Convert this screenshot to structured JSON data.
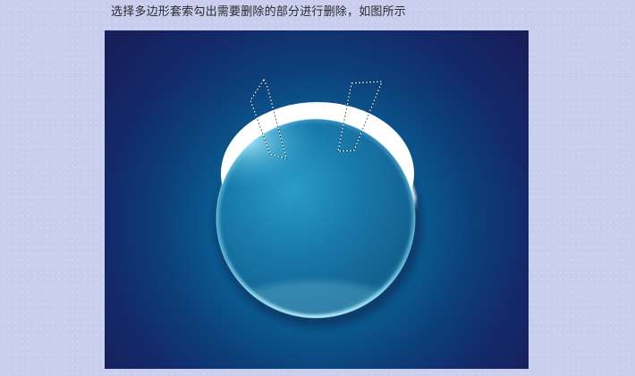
{
  "caption": "选择多边形套索勾出需要删除的部分进行删除，如图所示",
  "canvas": {
    "background_inner": "#0e6fa0",
    "background_outer": "#171f5a",
    "orb_color": "#1a7fb0",
    "highlight_color": "#ffffff"
  },
  "selections": [
    {
      "name": "left-lasso-selection",
      "style": "marching-ants"
    },
    {
      "name": "right-lasso-selection",
      "style": "marching-ants"
    }
  ]
}
